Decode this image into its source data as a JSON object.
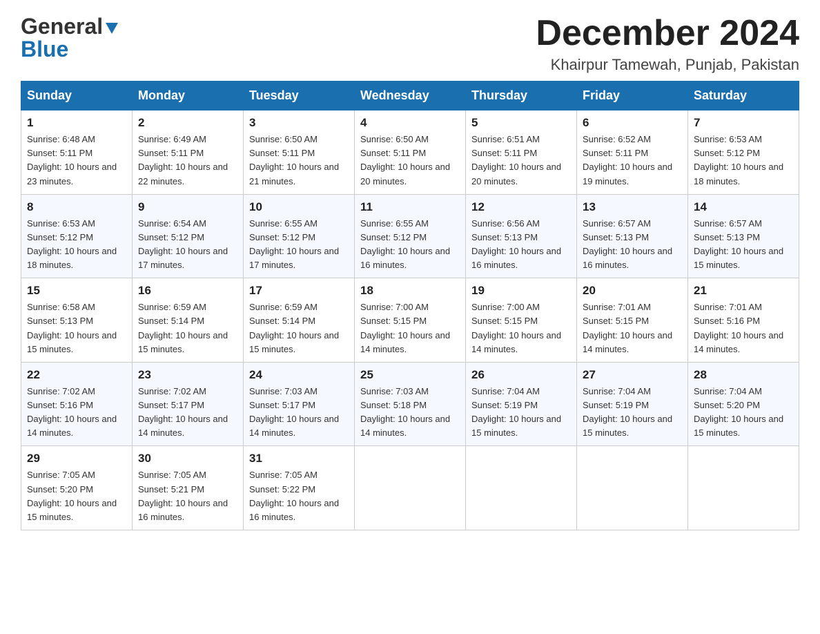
{
  "header": {
    "logo_general": "General",
    "logo_blue": "Blue",
    "month_title": "December 2024",
    "location": "Khairpur Tamewah, Punjab, Pakistan"
  },
  "days_of_week": [
    "Sunday",
    "Monday",
    "Tuesday",
    "Wednesday",
    "Thursday",
    "Friday",
    "Saturday"
  ],
  "weeks": [
    [
      {
        "day": "1",
        "sunrise": "Sunrise: 6:48 AM",
        "sunset": "Sunset: 5:11 PM",
        "daylight": "Daylight: 10 hours and 23 minutes."
      },
      {
        "day": "2",
        "sunrise": "Sunrise: 6:49 AM",
        "sunset": "Sunset: 5:11 PM",
        "daylight": "Daylight: 10 hours and 22 minutes."
      },
      {
        "day": "3",
        "sunrise": "Sunrise: 6:50 AM",
        "sunset": "Sunset: 5:11 PM",
        "daylight": "Daylight: 10 hours and 21 minutes."
      },
      {
        "day": "4",
        "sunrise": "Sunrise: 6:50 AM",
        "sunset": "Sunset: 5:11 PM",
        "daylight": "Daylight: 10 hours and 20 minutes."
      },
      {
        "day": "5",
        "sunrise": "Sunrise: 6:51 AM",
        "sunset": "Sunset: 5:11 PM",
        "daylight": "Daylight: 10 hours and 20 minutes."
      },
      {
        "day": "6",
        "sunrise": "Sunrise: 6:52 AM",
        "sunset": "Sunset: 5:11 PM",
        "daylight": "Daylight: 10 hours and 19 minutes."
      },
      {
        "day": "7",
        "sunrise": "Sunrise: 6:53 AM",
        "sunset": "Sunset: 5:12 PM",
        "daylight": "Daylight: 10 hours and 18 minutes."
      }
    ],
    [
      {
        "day": "8",
        "sunrise": "Sunrise: 6:53 AM",
        "sunset": "Sunset: 5:12 PM",
        "daylight": "Daylight: 10 hours and 18 minutes."
      },
      {
        "day": "9",
        "sunrise": "Sunrise: 6:54 AM",
        "sunset": "Sunset: 5:12 PM",
        "daylight": "Daylight: 10 hours and 17 minutes."
      },
      {
        "day": "10",
        "sunrise": "Sunrise: 6:55 AM",
        "sunset": "Sunset: 5:12 PM",
        "daylight": "Daylight: 10 hours and 17 minutes."
      },
      {
        "day": "11",
        "sunrise": "Sunrise: 6:55 AM",
        "sunset": "Sunset: 5:12 PM",
        "daylight": "Daylight: 10 hours and 16 minutes."
      },
      {
        "day": "12",
        "sunrise": "Sunrise: 6:56 AM",
        "sunset": "Sunset: 5:13 PM",
        "daylight": "Daylight: 10 hours and 16 minutes."
      },
      {
        "day": "13",
        "sunrise": "Sunrise: 6:57 AM",
        "sunset": "Sunset: 5:13 PM",
        "daylight": "Daylight: 10 hours and 16 minutes."
      },
      {
        "day": "14",
        "sunrise": "Sunrise: 6:57 AM",
        "sunset": "Sunset: 5:13 PM",
        "daylight": "Daylight: 10 hours and 15 minutes."
      }
    ],
    [
      {
        "day": "15",
        "sunrise": "Sunrise: 6:58 AM",
        "sunset": "Sunset: 5:13 PM",
        "daylight": "Daylight: 10 hours and 15 minutes."
      },
      {
        "day": "16",
        "sunrise": "Sunrise: 6:59 AM",
        "sunset": "Sunset: 5:14 PM",
        "daylight": "Daylight: 10 hours and 15 minutes."
      },
      {
        "day": "17",
        "sunrise": "Sunrise: 6:59 AM",
        "sunset": "Sunset: 5:14 PM",
        "daylight": "Daylight: 10 hours and 15 minutes."
      },
      {
        "day": "18",
        "sunrise": "Sunrise: 7:00 AM",
        "sunset": "Sunset: 5:15 PM",
        "daylight": "Daylight: 10 hours and 14 minutes."
      },
      {
        "day": "19",
        "sunrise": "Sunrise: 7:00 AM",
        "sunset": "Sunset: 5:15 PM",
        "daylight": "Daylight: 10 hours and 14 minutes."
      },
      {
        "day": "20",
        "sunrise": "Sunrise: 7:01 AM",
        "sunset": "Sunset: 5:15 PM",
        "daylight": "Daylight: 10 hours and 14 minutes."
      },
      {
        "day": "21",
        "sunrise": "Sunrise: 7:01 AM",
        "sunset": "Sunset: 5:16 PM",
        "daylight": "Daylight: 10 hours and 14 minutes."
      }
    ],
    [
      {
        "day": "22",
        "sunrise": "Sunrise: 7:02 AM",
        "sunset": "Sunset: 5:16 PM",
        "daylight": "Daylight: 10 hours and 14 minutes."
      },
      {
        "day": "23",
        "sunrise": "Sunrise: 7:02 AM",
        "sunset": "Sunset: 5:17 PM",
        "daylight": "Daylight: 10 hours and 14 minutes."
      },
      {
        "day": "24",
        "sunrise": "Sunrise: 7:03 AM",
        "sunset": "Sunset: 5:17 PM",
        "daylight": "Daylight: 10 hours and 14 minutes."
      },
      {
        "day": "25",
        "sunrise": "Sunrise: 7:03 AM",
        "sunset": "Sunset: 5:18 PM",
        "daylight": "Daylight: 10 hours and 14 minutes."
      },
      {
        "day": "26",
        "sunrise": "Sunrise: 7:04 AM",
        "sunset": "Sunset: 5:19 PM",
        "daylight": "Daylight: 10 hours and 15 minutes."
      },
      {
        "day": "27",
        "sunrise": "Sunrise: 7:04 AM",
        "sunset": "Sunset: 5:19 PM",
        "daylight": "Daylight: 10 hours and 15 minutes."
      },
      {
        "day": "28",
        "sunrise": "Sunrise: 7:04 AM",
        "sunset": "Sunset: 5:20 PM",
        "daylight": "Daylight: 10 hours and 15 minutes."
      }
    ],
    [
      {
        "day": "29",
        "sunrise": "Sunrise: 7:05 AM",
        "sunset": "Sunset: 5:20 PM",
        "daylight": "Daylight: 10 hours and 15 minutes."
      },
      {
        "day": "30",
        "sunrise": "Sunrise: 7:05 AM",
        "sunset": "Sunset: 5:21 PM",
        "daylight": "Daylight: 10 hours and 16 minutes."
      },
      {
        "day": "31",
        "sunrise": "Sunrise: 7:05 AM",
        "sunset": "Sunset: 5:22 PM",
        "daylight": "Daylight: 10 hours and 16 minutes."
      },
      null,
      null,
      null,
      null
    ]
  ]
}
